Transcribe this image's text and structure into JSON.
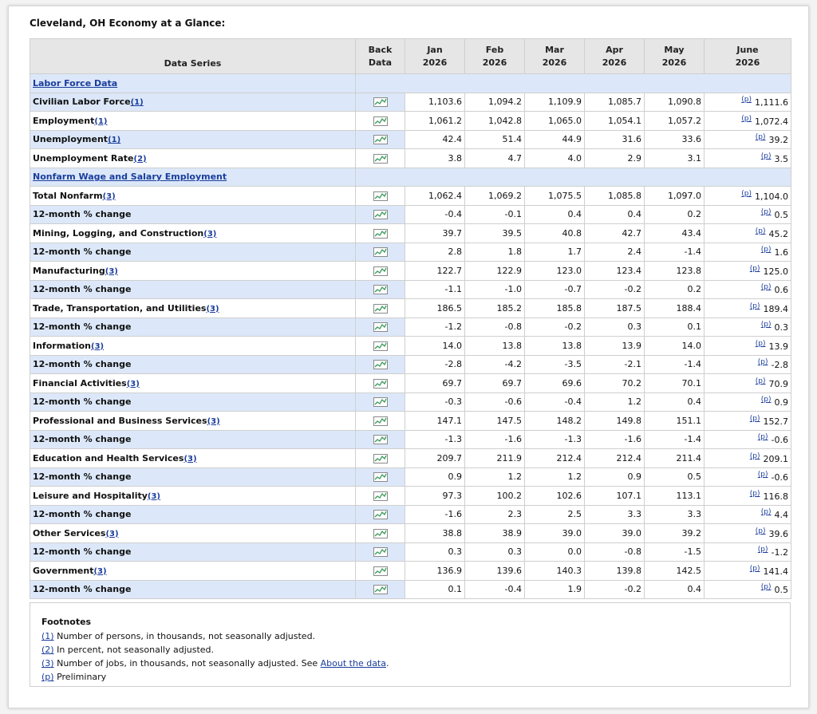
{
  "title": "Cleveland, OH Economy at a Glance:",
  "header": {
    "series": "Data Series",
    "back_data": [
      "Back",
      "Data"
    ],
    "months": [
      [
        "Jan",
        "2026"
      ],
      [
        "Feb",
        "2026"
      ],
      [
        "Mar",
        "2026"
      ],
      [
        "Apr",
        "2026"
      ],
      [
        "May",
        "2026"
      ],
      [
        "June",
        "2026"
      ]
    ]
  },
  "preliminary_mark": "(p)",
  "rows": [
    {
      "type": "section",
      "label": "Labor Force Data"
    },
    {
      "type": "data",
      "label": "Civilian Labor Force",
      "fn": "(1)",
      "indent": true,
      "shade": true,
      "values": [
        "1,103.6",
        "1,094.2",
        "1,109.9",
        "1,085.7",
        "1,090.8"
      ],
      "june": "1,111.6"
    },
    {
      "type": "data",
      "label": "Employment",
      "fn": "(1)",
      "indent": true,
      "shade": false,
      "values": [
        "1,061.2",
        "1,042.8",
        "1,065.0",
        "1,054.1",
        "1,057.2"
      ],
      "june": "1,072.4"
    },
    {
      "type": "data",
      "label": "Unemployment",
      "fn": "(1)",
      "indent": true,
      "shade": true,
      "values": [
        "42.4",
        "51.4",
        "44.9",
        "31.6",
        "33.6"
      ],
      "june": "39.2"
    },
    {
      "type": "data",
      "label": "Unemployment Rate",
      "fn": "(2)",
      "indent": true,
      "shade": false,
      "values": [
        "3.8",
        "4.7",
        "4.0",
        "2.9",
        "3.1"
      ],
      "june": "3.5"
    },
    {
      "type": "section",
      "label": "Nonfarm Wage and Salary Employment"
    },
    {
      "type": "data",
      "label": "Total Nonfarm",
      "fn": "(3)",
      "indent": false,
      "shade": false,
      "values": [
        "1,062.4",
        "1,069.2",
        "1,075.5",
        "1,085.8",
        "1,097.0"
      ],
      "june": "1,104.0"
    },
    {
      "type": "data",
      "label": "12-month % change",
      "fn": "",
      "indent": true,
      "shade": true,
      "values": [
        "-0.4",
        "-0.1",
        "0.4",
        "0.4",
        "0.2"
      ],
      "june": "0.5"
    },
    {
      "type": "data",
      "label": "Mining, Logging, and Construction",
      "fn": "(3)",
      "indent": false,
      "shade": false,
      "values": [
        "39.7",
        "39.5",
        "40.8",
        "42.7",
        "43.4"
      ],
      "june": "45.2"
    },
    {
      "type": "data",
      "label": "12-month % change",
      "fn": "",
      "indent": true,
      "shade": true,
      "values": [
        "2.8",
        "1.8",
        "1.7",
        "2.4",
        "-1.4"
      ],
      "june": "1.6"
    },
    {
      "type": "data",
      "label": "Manufacturing",
      "fn": "(3)",
      "indent": false,
      "shade": false,
      "values": [
        "122.7",
        "122.9",
        "123.0",
        "123.4",
        "123.8"
      ],
      "june": "125.0"
    },
    {
      "type": "data",
      "label": "12-month % change",
      "fn": "",
      "indent": true,
      "shade": true,
      "values": [
        "-1.1",
        "-1.0",
        "-0.7",
        "-0.2",
        "0.2"
      ],
      "june": "0.6"
    },
    {
      "type": "data",
      "label": "Trade, Transportation, and Utilities",
      "fn": "(3)",
      "indent": false,
      "shade": false,
      "values": [
        "186.5",
        "185.2",
        "185.8",
        "187.5",
        "188.4"
      ],
      "june": "189.4"
    },
    {
      "type": "data",
      "label": "12-month % change",
      "fn": "",
      "indent": true,
      "shade": true,
      "values": [
        "-1.2",
        "-0.8",
        "-0.2",
        "0.3",
        "0.1"
      ],
      "june": "0.3"
    },
    {
      "type": "data",
      "label": "Information",
      "fn": "(3)",
      "indent": false,
      "shade": false,
      "values": [
        "14.0",
        "13.8",
        "13.8",
        "13.9",
        "14.0"
      ],
      "june": "13.9"
    },
    {
      "type": "data",
      "label": "12-month % change",
      "fn": "",
      "indent": true,
      "shade": true,
      "values": [
        "-2.8",
        "-4.2",
        "-3.5",
        "-2.1",
        "-1.4"
      ],
      "june": "-2.8"
    },
    {
      "type": "data",
      "label": "Financial Activities",
      "fn": "(3)",
      "indent": false,
      "shade": false,
      "values": [
        "69.7",
        "69.7",
        "69.6",
        "70.2",
        "70.1"
      ],
      "june": "70.9"
    },
    {
      "type": "data",
      "label": "12-month % change",
      "fn": "",
      "indent": true,
      "shade": true,
      "values": [
        "-0.3",
        "-0.6",
        "-0.4",
        "1.2",
        "0.4"
      ],
      "june": "0.9"
    },
    {
      "type": "data",
      "label": "Professional and Business Services",
      "fn": "(3)",
      "indent": false,
      "shade": false,
      "values": [
        "147.1",
        "147.5",
        "148.2",
        "149.8",
        "151.1"
      ],
      "june": "152.7"
    },
    {
      "type": "data",
      "label": "12-month % change",
      "fn": "",
      "indent": true,
      "shade": true,
      "values": [
        "-1.3",
        "-1.6",
        "-1.3",
        "-1.6",
        "-1.4"
      ],
      "june": "-0.6"
    },
    {
      "type": "data",
      "label": "Education and Health Services",
      "fn": "(3)",
      "indent": false,
      "shade": false,
      "values": [
        "209.7",
        "211.9",
        "212.4",
        "212.4",
        "211.4"
      ],
      "june": "209.1"
    },
    {
      "type": "data",
      "label": "12-month % change",
      "fn": "",
      "indent": true,
      "shade": true,
      "values": [
        "0.9",
        "1.2",
        "1.2",
        "0.9",
        "0.5"
      ],
      "june": "-0.6"
    },
    {
      "type": "data",
      "label": "Leisure and Hospitality",
      "fn": "(3)",
      "indent": false,
      "shade": false,
      "values": [
        "97.3",
        "100.2",
        "102.6",
        "107.1",
        "113.1"
      ],
      "june": "116.8"
    },
    {
      "type": "data",
      "label": "12-month % change",
      "fn": "",
      "indent": true,
      "shade": true,
      "values": [
        "-1.6",
        "2.3",
        "2.5",
        "3.3",
        "3.3"
      ],
      "june": "4.4"
    },
    {
      "type": "data",
      "label": "Other Services",
      "fn": "(3)",
      "indent": false,
      "shade": false,
      "values": [
        "38.8",
        "38.9",
        "39.0",
        "39.0",
        "39.2"
      ],
      "june": "39.6"
    },
    {
      "type": "data",
      "label": "12-month % change",
      "fn": "",
      "indent": true,
      "shade": true,
      "values": [
        "0.3",
        "0.3",
        "0.0",
        "-0.8",
        "-1.5"
      ],
      "june": "-1.2"
    },
    {
      "type": "data",
      "label": "Government",
      "fn": "(3)",
      "indent": false,
      "shade": false,
      "values": [
        "136.9",
        "139.6",
        "140.3",
        "139.8",
        "142.5"
      ],
      "june": "141.4"
    },
    {
      "type": "data",
      "label": "12-month % change",
      "fn": "",
      "indent": true,
      "shade": true,
      "values": [
        "0.1",
        "-0.4",
        "1.9",
        "-0.2",
        "0.4"
      ],
      "june": "0.5"
    }
  ],
  "footnotes": {
    "heading": "Footnotes",
    "items": [
      {
        "mark": "(1)",
        "text": "Number of persons, in thousands, not seasonally adjusted."
      },
      {
        "mark": "(2)",
        "text": "In percent, not seasonally adjusted."
      },
      {
        "mark": "(3)",
        "text": "Number of jobs, in thousands, not seasonally adjusted. See ",
        "link": "About the data",
        "after": "."
      },
      {
        "mark": "(p)",
        "text": "Preliminary"
      }
    ]
  },
  "colors": {
    "link": "#1a3d9c",
    "shade": "#dce8f9",
    "header": "#e6e6e6",
    "icon": "#3a9a5a"
  },
  "icon_name": "line-chart-icon"
}
